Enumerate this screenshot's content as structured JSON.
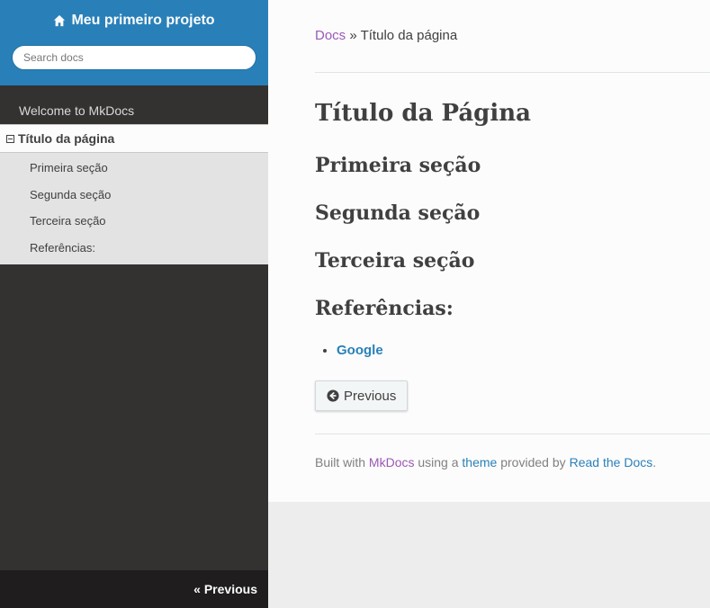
{
  "sidebar": {
    "project_title": "Meu primeiro projeto",
    "search_placeholder": "Search docs",
    "nav_top": "Welcome to MkDocs",
    "current_page": "Título da página",
    "sub_items": [
      "Primeira seção",
      "Segunda seção",
      "Terceira seção",
      "Referências:"
    ],
    "footer_prev": "« Previous"
  },
  "breadcrumb": {
    "docs": "Docs",
    "current": "» Título da página"
  },
  "content": {
    "title": "Título da Página",
    "sections": [
      "Primeira seção",
      "Segunda seção",
      "Terceira seção",
      "Referências:"
    ],
    "refs": [
      "Google"
    ],
    "prev_label": "Previous"
  },
  "footer": {
    "built_with": "Built with",
    "mkdocs": "MkDocs",
    "using_a": "using a",
    "theme": "theme",
    "provided_by": "provided by",
    "rtd": "Read the Docs",
    "period": "."
  },
  "colors": {
    "sidebar_header": "#2980b9",
    "sidebar_bg": "#343131",
    "link": "#2980b9",
    "visited_link": "#9b59b6"
  }
}
